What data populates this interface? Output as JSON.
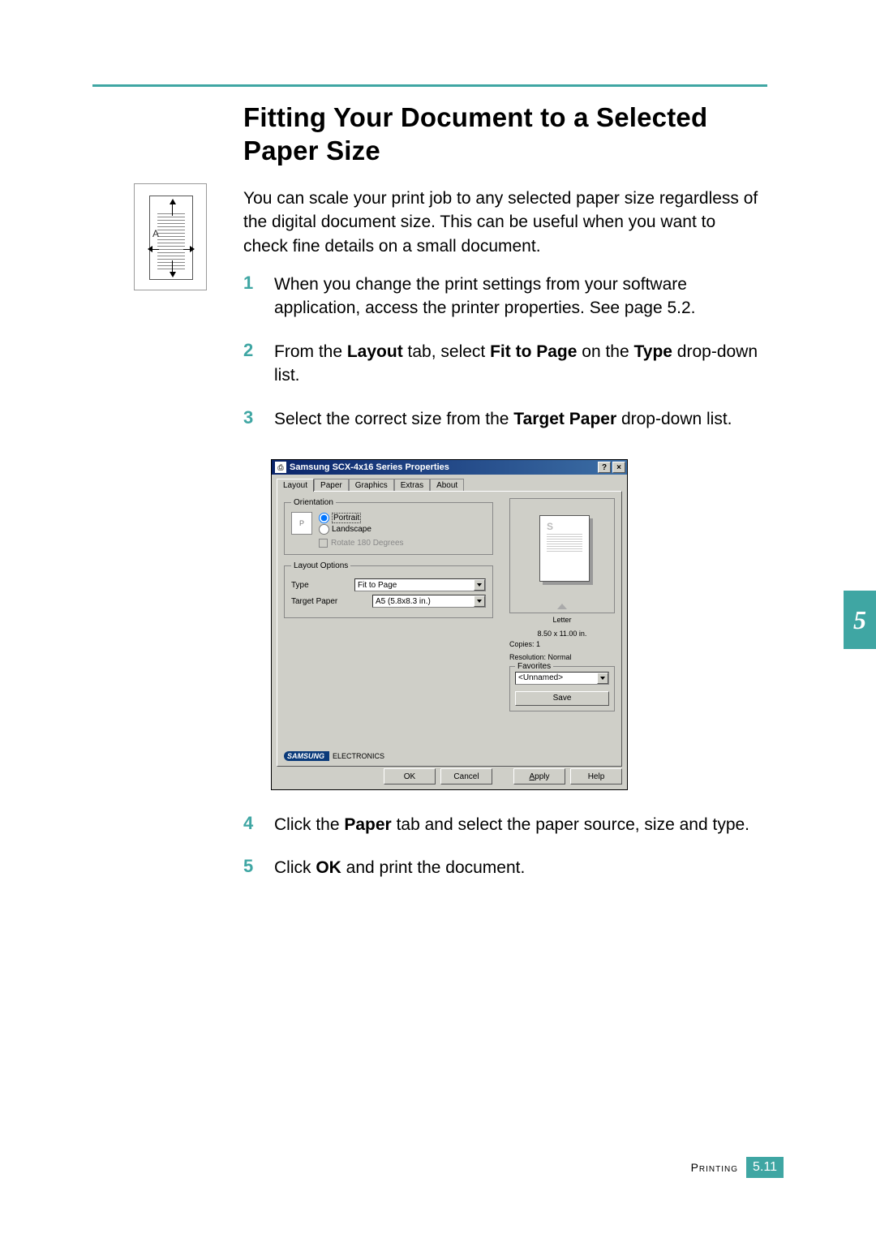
{
  "title": "Fitting Your Document to a Selected Paper Size",
  "intro": "You can scale your print job to any selected paper size regardless of the digital document size. This can be useful when you want to check fine details on a small document.",
  "icon_label": "A",
  "steps": [
    {
      "n": "1",
      "pre": "When you change the print settings from your software application, access the printer properties. See page 5.2.",
      "bolds": []
    },
    {
      "n": "2",
      "pre": "From the ",
      "b1": "Layout",
      "mid1": " tab, select ",
      "b2": "Fit to Page",
      "mid2": " on the ",
      "b3": "Type",
      "post": " drop-down list."
    },
    {
      "n": "3",
      "pre": "Select the correct size from the ",
      "b1": "Target Paper",
      "post": " drop-down list."
    }
  ],
  "steps_after": [
    {
      "n": "4",
      "pre": "Click the ",
      "b1": "Paper",
      "post": " tab and select the paper source, size and type."
    },
    {
      "n": "5",
      "pre": "Click ",
      "b1": "OK",
      "post": " and print the document."
    }
  ],
  "dialog": {
    "title": "Samsung SCX-4x16 Series Properties",
    "help_btn": "?",
    "close_btn": "×",
    "tabs": [
      "Layout",
      "Paper",
      "Graphics",
      "Extras",
      "About"
    ],
    "orientation": {
      "legend": "Orientation",
      "portrait": "Portrait",
      "landscape": "Landscape",
      "rotate": "Rotate 180 Degrees"
    },
    "layout_options": {
      "legend": "Layout Options",
      "type_label": "Type",
      "type_value": "Fit to Page",
      "target_label": "Target Paper",
      "target_value": "A5 (5.8x8.3 in.)"
    },
    "preview": {
      "paper_name": "Letter",
      "paper_dims": "8.50 x 11.00 in.",
      "copies": "Copies: 1",
      "resolution": "Resolution: Normal"
    },
    "favorites": {
      "legend": "Favorites",
      "value": "<Unnamed>",
      "save": "Save"
    },
    "brand": "SAMSUNG",
    "brand_sub": "ELECTRONICS",
    "buttons": {
      "ok": "OK",
      "cancel": "Cancel",
      "apply": "Apply",
      "help": "Help"
    }
  },
  "chapter_tab": "5",
  "footer": {
    "section": "Printing",
    "page_chapter": "5",
    "page_dot": ".",
    "page_num": "11"
  }
}
